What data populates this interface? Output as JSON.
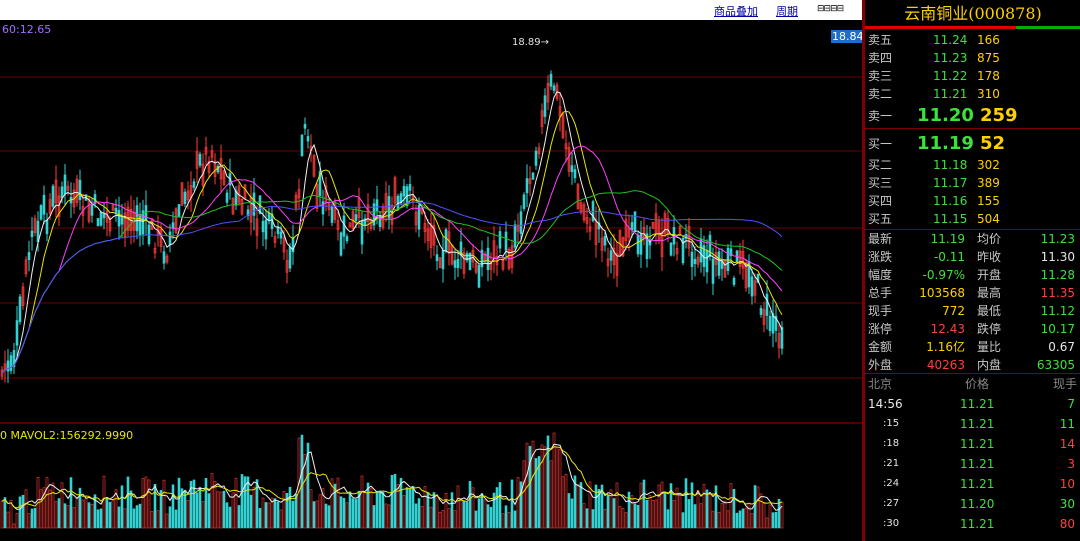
{
  "toolbar": {
    "overlay": "商品叠加",
    "period": "周期"
  },
  "chart": {
    "ma_label": "60:12.65",
    "price_tag": "18.84",
    "peak_label": "18.89→",
    "vol_label": "0 MAVOL2:156292.9990"
  },
  "stock": {
    "name": "云南铜业",
    "code": "(000878)"
  },
  "asks": [
    {
      "label": "卖五",
      "price": "11.24",
      "vol": "166"
    },
    {
      "label": "卖四",
      "price": "11.23",
      "vol": "875"
    },
    {
      "label": "卖三",
      "price": "11.22",
      "vol": "178"
    },
    {
      "label": "卖二",
      "price": "11.21",
      "vol": "310"
    },
    {
      "label": "卖一",
      "price": "11.20",
      "vol": "259"
    }
  ],
  "bids": [
    {
      "label": "买一",
      "price": "11.19",
      "vol": "52"
    },
    {
      "label": "买二",
      "price": "11.18",
      "vol": "302"
    },
    {
      "label": "买三",
      "price": "11.17",
      "vol": "389"
    },
    {
      "label": "买四",
      "price": "11.16",
      "vol": "155"
    },
    {
      "label": "买五",
      "price": "11.15",
      "vol": "504"
    }
  ],
  "stats": [
    {
      "l1": "最新",
      "v1": "11.19",
      "c1": "green",
      "l2": "均价",
      "v2": "11.23",
      "c2": "green"
    },
    {
      "l1": "涨跌",
      "v1": "-0.11",
      "c1": "green",
      "l2": "昨收",
      "v2": "11.30",
      "c2": "white"
    },
    {
      "l1": "幅度",
      "v1": "-0.97%",
      "c1": "green",
      "l2": "开盘",
      "v2": "11.28",
      "c2": "green"
    },
    {
      "l1": "总手",
      "v1": "103568",
      "c1": "yellow",
      "l2": "最高",
      "v2": "11.35",
      "c2": "red"
    },
    {
      "l1": "现手",
      "v1": "772",
      "c1": "yellow",
      "l2": "最低",
      "v2": "11.12",
      "c2": "green"
    },
    {
      "l1": "涨停",
      "v1": "12.43",
      "c1": "red",
      "l2": "跌停",
      "v2": "10.17",
      "c2": "green"
    },
    {
      "l1": "金额",
      "v1": "1.16亿",
      "c1": "yellow",
      "l2": "量比",
      "v2": "0.67",
      "c2": "white"
    },
    {
      "l1": "外盘",
      "v1": "40263",
      "c1": "red",
      "l2": "内盘",
      "v2": "63305",
      "c2": "green"
    }
  ],
  "ticks_header": {
    "market": "北京",
    "price": "价格",
    "vol": "现手"
  },
  "ticks": [
    {
      "time": "14:56",
      "price": "11.21",
      "vol": "7",
      "vc": "green"
    },
    {
      "time": ":15",
      "price": "11.21",
      "vol": "11",
      "vc": "green"
    },
    {
      "time": ":18",
      "price": "11.21",
      "vol": "14",
      "vc": "red"
    },
    {
      "time": ":21",
      "price": "11.21",
      "vol": "3",
      "vc": "red"
    },
    {
      "time": ":24",
      "price": "11.21",
      "vol": "10",
      "vc": "red"
    },
    {
      "time": ":27",
      "price": "11.20",
      "vol": "30",
      "vc": "green"
    },
    {
      "time": ":30",
      "price": "11.21",
      "vol": "80",
      "vc": "red"
    }
  ]
}
